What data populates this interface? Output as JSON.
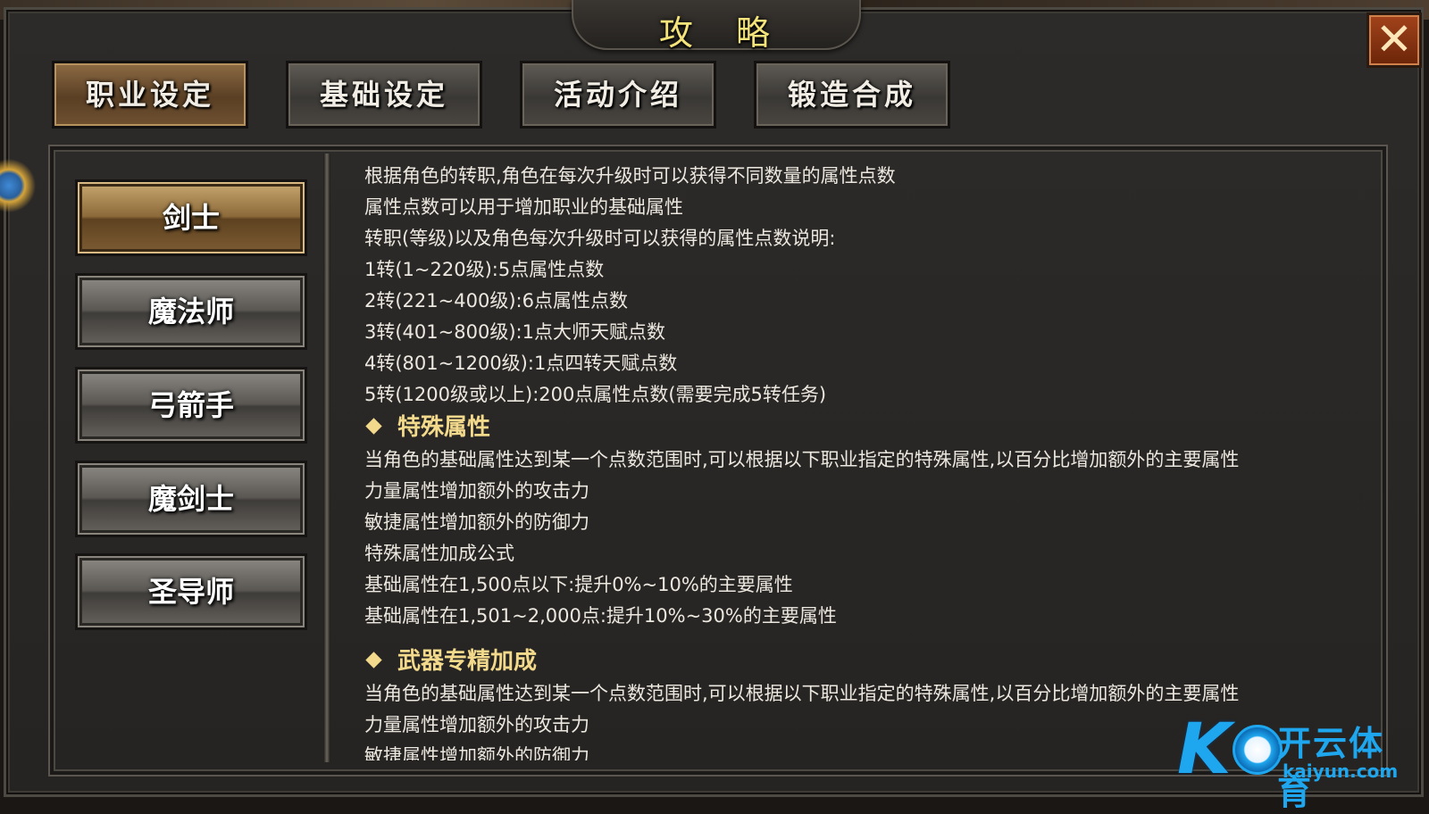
{
  "window": {
    "title": "攻略",
    "close_icon": "close-x-icon"
  },
  "top_tabs": [
    {
      "label": "职业设定",
      "active": true
    },
    {
      "label": "基础设定",
      "active": false
    },
    {
      "label": "活动介绍",
      "active": false
    },
    {
      "label": "锻造合成",
      "active": false
    }
  ],
  "classes": [
    {
      "label": "剑士",
      "active": true
    },
    {
      "label": "魔法师",
      "active": false
    },
    {
      "label": "弓箭手",
      "active": false
    },
    {
      "label": "魔剑士",
      "active": false
    },
    {
      "label": "圣导师",
      "active": false
    }
  ],
  "content": {
    "intro": [
      "根据角色的转职,角色在每次升级时可以获得不同数量的属性点数",
      "属性点数可以用于增加职业的基础属性",
      "转职(等级)以及角色每次升级时可以获得的属性点数说明:",
      "1转(1~220级):5点属性点数",
      "2转(221~400级):6点属性点数",
      "3转(401~800级):1点大师天赋点数",
      "4转(801~1200级):1点四转天赋点数",
      "5转(1200级或以上):200点属性点数(需要完成5转任务)"
    ],
    "section1": {
      "heading": "特殊属性",
      "lines": [
        "当角色的基础属性达到某一个点数范围时,可以根据以下职业指定的特殊属性,以百分比增加额外的主要属性",
        "力量属性增加额外的攻击力",
        "敏捷属性增加额外的防御力",
        "特殊属性加成公式",
        "基础属性在1,500点以下:提升0%~10%的主要属性",
        "基础属性在1,501~2,000点:提升10%~30%的主要属性"
      ]
    },
    "section2": {
      "heading": "武器专精加成",
      "lines": [
        "当角色的基础属性达到某一个点数范围时,可以根据以下职业指定的特殊属性,以百分比增加额外的主要属性",
        "力量属性增加额外的攻击力",
        "敏捷属性增加额外的防御力"
      ]
    }
  },
  "watermark": {
    "brand": "开云体育",
    "url": "kaiyun.com",
    "colors": {
      "accent": "#1ea7ee"
    }
  },
  "colors": {
    "title_text": "#f4e27a",
    "heading_text": "#f2d98b",
    "body_text": "#ece8e0",
    "close_button": "#a2431b"
  }
}
